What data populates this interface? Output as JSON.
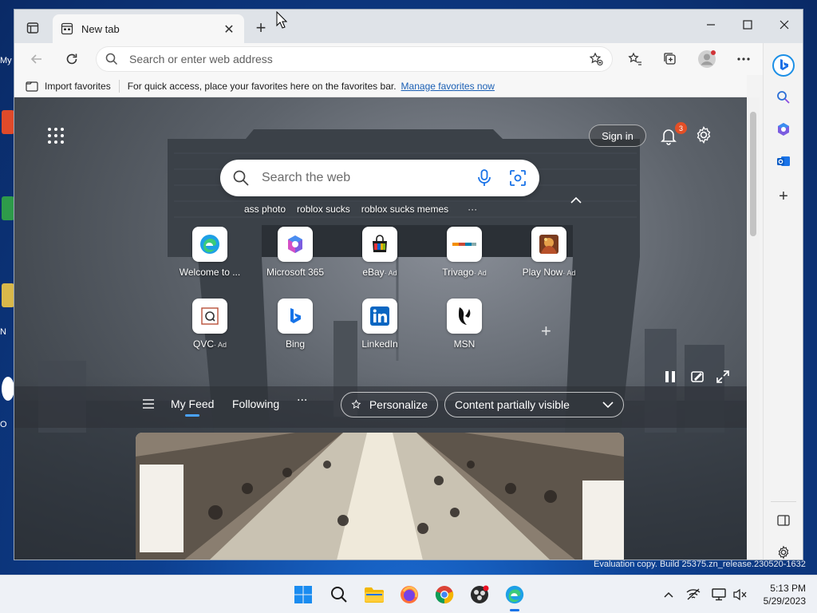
{
  "desktop": {
    "labels": [
      "My",
      "N",
      "O"
    ]
  },
  "browser": {
    "tab_title": "New tab",
    "address_placeholder": "Search or enter web address",
    "favorites_bar": {
      "import_label": "Import favorites",
      "hint": "For quick access, place your favorites here on the favorites bar.",
      "manage_link": "Manage favorites now"
    }
  },
  "newtab": {
    "signin_label": "Sign in",
    "notification_count": "3",
    "search_placeholder": "Search the web",
    "trending": [
      "ass photo",
      "roblox sucks",
      "roblox sucks memes"
    ],
    "tiles": [
      {
        "label": "Welcome to ...",
        "ad": ""
      },
      {
        "label": "Microsoft 365",
        "ad": ""
      },
      {
        "label": "eBay",
        "ad": "· Ad"
      },
      {
        "label": "Trivago",
        "ad": "· Ad"
      },
      {
        "label": "Play Now",
        "ad": "· Ad"
      },
      {
        "label": "QVC",
        "ad": "· Ad"
      },
      {
        "label": "Bing",
        "ad": ""
      },
      {
        "label": "LinkedIn",
        "ad": ""
      },
      {
        "label": "MSN",
        "ad": ""
      }
    ],
    "feed": {
      "tab_my_feed": "My Feed",
      "tab_following": "Following",
      "more": "···",
      "personalize": "Personalize",
      "content_visibility": "Content partially visible"
    }
  },
  "taskbar": {
    "time": "5:13 PM",
    "date": "5/29/2023",
    "watermark": "Evaluation copy. Build 25375.zn_release.230520-1632"
  },
  "colors": {
    "accent": "#0078d4",
    "badge": "#e34f26",
    "link": "#1a5fb4"
  }
}
